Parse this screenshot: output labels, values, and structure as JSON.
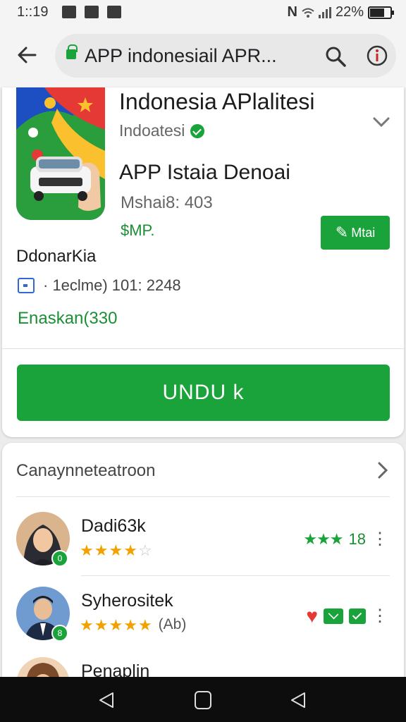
{
  "status_bar": {
    "time": "1::19",
    "battery": "22%",
    "battery_level": 0.7,
    "notification_icons": [
      "notification-icon",
      "notification-icon",
      "notification-icon"
    ],
    "right_icons": [
      "nfc-icon",
      "wifi-icon",
      "signal-icon",
      "battery-icon"
    ]
  },
  "app_bar": {
    "url_text": "APP indonesiail APR...",
    "icons": [
      "back-arrow-icon",
      "lock-icon",
      "search-icon",
      "info-icon"
    ]
  },
  "app_card": {
    "title": "Indonesia APlalitesi",
    "developer": "Indoatesi",
    "subtitle": "APP Istaia Denoai",
    "meta": "Mshai8: 403",
    "price": "$MP.",
    "small_button_label": "Mtai",
    "section_title": "DdonarKia",
    "info_line": "·  1eclme) 101: 2248",
    "link_text": "Enaskan(330",
    "install_label": "UNDU k"
  },
  "reviews_card": {
    "header": "Canaynneteatroon",
    "reviews": [
      {
        "name": "Dadi63k",
        "stars": 4,
        "badge": "0",
        "count": "18"
      },
      {
        "name": "Syherositek",
        "stars": 5,
        "extra": "(Ab)",
        "badge": "8"
      },
      {
        "name": "Penaplin"
      }
    ]
  },
  "nav_bar": {
    "icons": [
      "nav-back-icon",
      "nav-home-icon",
      "nav-recent-icon"
    ]
  },
  "colors": {
    "accent_green": "#1aa33a",
    "link_green": "#1a8f34",
    "star_gold": "#f2a200",
    "heart_red": "#e53935"
  }
}
